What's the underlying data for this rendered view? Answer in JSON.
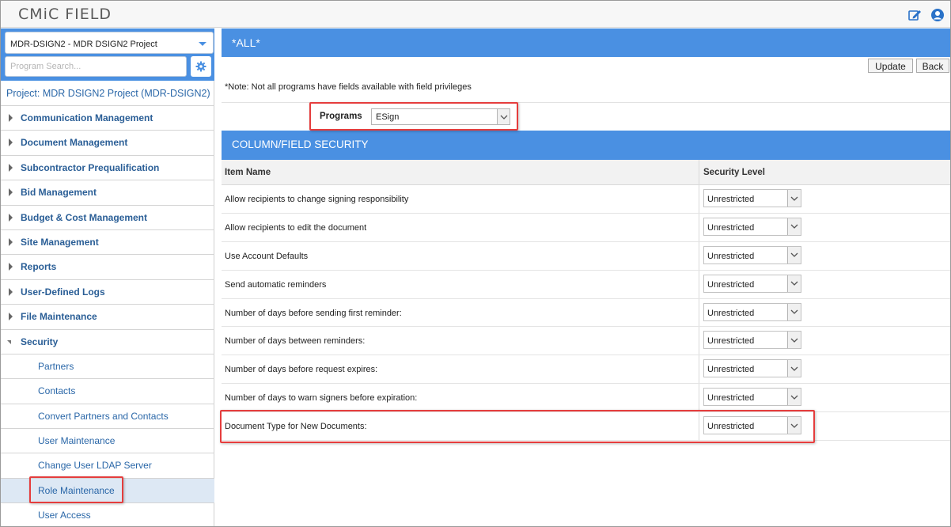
{
  "app": {
    "title": "CMiC FIELD"
  },
  "sidebar": {
    "project_select": "MDR-DSIGN2 - MDR DSIGN2 Project",
    "search_placeholder": "Program Search...",
    "project_label": "Project: MDR DSIGN2 Project (MDR-DSIGN2)",
    "nav": [
      "Communication Management",
      "Document Management",
      "Subcontractor Prequalification",
      "Bid Management",
      "Budget & Cost Management",
      "Site Management",
      "Reports",
      "User-Defined Logs",
      "File Maintenance",
      "Security"
    ],
    "security_items": [
      "Partners",
      "Contacts",
      "Convert Partners and Contacts",
      "User Maintenance",
      "Change User LDAP Server",
      "Role Maintenance",
      "User Access"
    ]
  },
  "main": {
    "header": "*ALL*",
    "update_label": "Update",
    "back_label": "Back",
    "note": "*Note: Not all programs have fields available with field privileges",
    "programs_label": "Programs",
    "programs_value": "ESign",
    "section_header": "COLUMN/FIELD SECURITY",
    "columns": {
      "item": "Item Name",
      "security": "Security Level"
    },
    "rows": [
      {
        "item": "Allow recipients to change signing responsibility",
        "level": "Unrestricted"
      },
      {
        "item": "Allow recipients to edit the document",
        "level": "Unrestricted"
      },
      {
        "item": "Use Account Defaults",
        "level": "Unrestricted"
      },
      {
        "item": "Send automatic reminders",
        "level": "Unrestricted"
      },
      {
        "item": "Number of days before sending first reminder:",
        "level": "Unrestricted"
      },
      {
        "item": "Number of days between reminders:",
        "level": "Unrestricted"
      },
      {
        "item": "Number of days before request expires:",
        "level": "Unrestricted"
      },
      {
        "item": "Number of days to warn signers before expiration:",
        "level": "Unrestricted"
      },
      {
        "item": "Document Type for New Documents:",
        "level": "Unrestricted"
      }
    ]
  },
  "colors": {
    "accent": "#4a90e2",
    "link": "#2a67a8",
    "highlight": "#e53d3d"
  }
}
